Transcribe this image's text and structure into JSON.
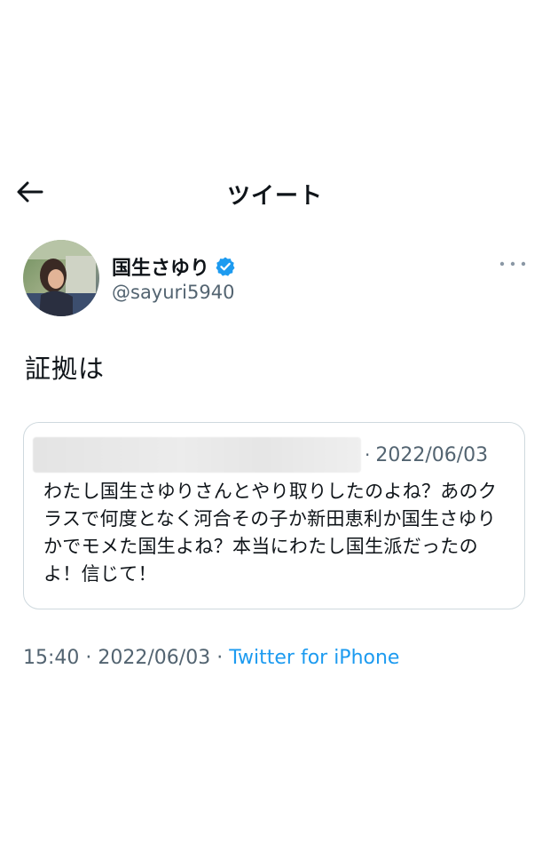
{
  "header": {
    "title": "ツイート",
    "back_icon": "arrow-left-icon"
  },
  "tweet": {
    "author": {
      "display_name": "国生さゆり",
      "handle": "@sayuri5940",
      "verified": true,
      "verified_color": "#1d9bf0"
    },
    "text": "証拠は",
    "more_icon": "more-horizontal-icon",
    "quote": {
      "separator": "·",
      "date": "2022/06/03",
      "text": "わたし国生さゆりさんとやり取りしたのよね？あのクラスで何度となく河合その子か新田恵利か国生さゆりかでモメた国生よね？本当にわたし国生派だったのよ！信じて！"
    },
    "meta": {
      "time": "15:40",
      "sep1": "·",
      "date": "2022/06/03",
      "sep2": "·",
      "source": "Twitter for iPhone"
    }
  },
  "colors": {
    "text": "#0f1419",
    "secondary": "#536471",
    "link": "#1d9bf0",
    "border": "#cfd9de"
  }
}
